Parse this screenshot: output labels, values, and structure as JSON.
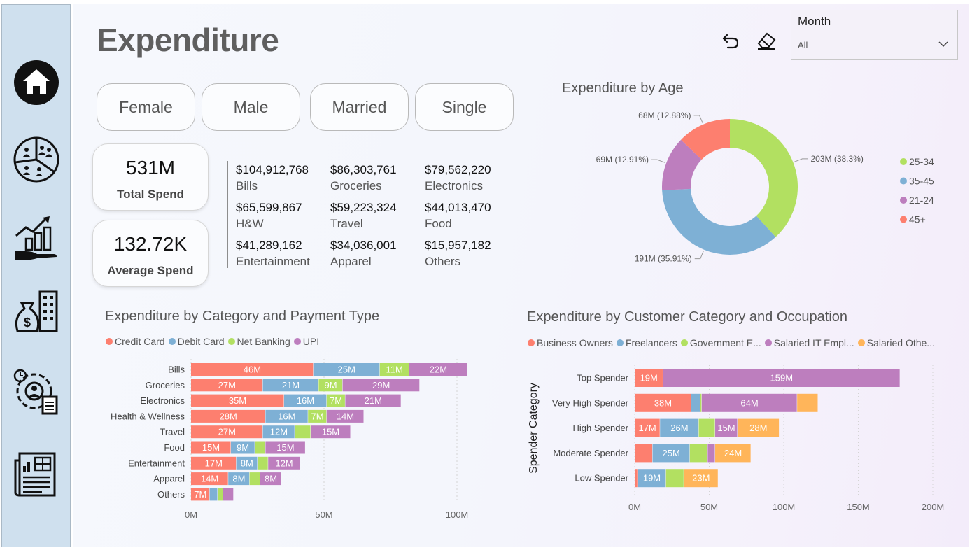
{
  "page": {
    "title": "Expenditure"
  },
  "toolbar": {
    "undo_icon": "undo-icon",
    "eraser_icon": "eraser-icon"
  },
  "slicer": {
    "title": "Month",
    "value": "All"
  },
  "sidebar": {
    "items": [
      {
        "name": "home",
        "icon": "home-icon"
      },
      {
        "name": "demographics",
        "icon": "people-pie-icon"
      },
      {
        "name": "growth",
        "icon": "money-growth-icon"
      },
      {
        "name": "finance",
        "icon": "money-bag-building-icon"
      },
      {
        "name": "settings-report",
        "icon": "gear-clock-document-icon"
      },
      {
        "name": "report",
        "icon": "newspaper-icon"
      }
    ]
  },
  "filters": [
    "Female",
    "Male",
    "Married",
    "Single"
  ],
  "kpis": {
    "total": {
      "value": "531M",
      "label": "Total Spend"
    },
    "average": {
      "value": "132.72K",
      "label": "Average Spend"
    }
  },
  "categories": [
    {
      "amount": "$104,912,768",
      "name": "Bills"
    },
    {
      "amount": "$86,303,761",
      "name": "Groceries"
    },
    {
      "amount": "$79,562,220",
      "name": "Electronics"
    },
    {
      "amount": "$65,599,867",
      "name": "H&W"
    },
    {
      "amount": "$59,223,324",
      "name": "Travel"
    },
    {
      "amount": "$44,013,470",
      "name": "Food"
    },
    {
      "amount": "$41,289,162",
      "name": "Entertainment"
    },
    {
      "amount": "$34,036,001",
      "name": "Apparel"
    },
    {
      "amount": "$15,957,182",
      "name": "Others"
    }
  ],
  "colors": {
    "credit_card": "#fd7f6f",
    "debit_card": "#7eb0d5",
    "net_banking": "#b2e061",
    "upi": "#bd7ebe",
    "salaried_other": "#ffb55a"
  },
  "chart_data": [
    {
      "type": "pie",
      "title": "Expenditure by Age",
      "variant": "donut",
      "categories": [
        "25-34",
        "35-45",
        "21-24",
        "45+"
      ],
      "values": [
        203,
        191,
        69,
        68
      ],
      "percent_labels": [
        "203M (38.3%)",
        "191M (35.91%)",
        "69M (12.91%)",
        "68M (12.88%)"
      ],
      "colors": [
        "#b2e061",
        "#7eb0d5",
        "#bd7ebe",
        "#fd7f6f"
      ],
      "legend": "right"
    },
    {
      "type": "bar",
      "orientation": "horizontal",
      "stacked": true,
      "title": "Expenditure by Category and Payment Type",
      "categories": [
        "Bills",
        "Groceries",
        "Electronics",
        "Health & Wellness",
        "Travel",
        "Food",
        "Entertainment",
        "Apparel",
        "Others"
      ],
      "series": [
        {
          "name": "Credit Card",
          "color": "#fd7f6f",
          "values": [
            46,
            27,
            35,
            28,
            27,
            15,
            17,
            14,
            7
          ]
        },
        {
          "name": "Debit Card",
          "color": "#7eb0d5",
          "values": [
            25,
            21,
            16,
            16,
            12,
            9,
            8,
            8,
            3
          ]
        },
        {
          "name": "Net Banking",
          "color": "#b2e061",
          "values": [
            11,
            9,
            7,
            7,
            6,
            4,
            4,
            4,
            2
          ]
        },
        {
          "name": "UPI",
          "color": "#bd7ebe",
          "values": [
            22,
            29,
            21,
            14,
            15,
            15,
            12,
            8,
            4
          ]
        }
      ],
      "data_labels": [
        [
          "46M",
          "25M",
          "11M",
          "22M"
        ],
        [
          "27M",
          "21M",
          "9M",
          "29M"
        ],
        [
          "35M",
          "16M",
          "7M",
          "21M"
        ],
        [
          "28M",
          "16M",
          "7M",
          "14M"
        ],
        [
          "27M",
          "12M",
          "",
          "15M"
        ],
        [
          "15M",
          "9M",
          "",
          "15M"
        ],
        [
          "17M",
          "8M",
          "",
          "12M"
        ],
        [
          "14M",
          "8M",
          "",
          "8M"
        ],
        [
          "7M",
          "",
          "",
          ""
        ]
      ],
      "x_ticks": [
        "0M",
        "50M",
        "100M"
      ],
      "x_tick_values": [
        0,
        50,
        100
      ],
      "xlim": [
        0,
        110
      ],
      "grid": true,
      "legend": "top-left"
    },
    {
      "type": "bar",
      "orientation": "horizontal",
      "stacked": true,
      "title": "Expenditure by Customer Category and Occupation",
      "ylabel": "Spender Category",
      "categories": [
        "Top Spender",
        "Very High Spender",
        "High Spender",
        "Moderate Spender",
        "Low Spender"
      ],
      "series": [
        {
          "name": "Business Owners",
          "color": "#fd7f6f",
          "values": [
            19,
            38,
            17,
            12,
            2
          ]
        },
        {
          "name": "Freelancers",
          "color": "#7eb0d5",
          "values": [
            0,
            6,
            26,
            25,
            19
          ]
        },
        {
          "name": "Government E...",
          "color": "#b2e061",
          "values": [
            0,
            1,
            11,
            12,
            12
          ]
        },
        {
          "name": "Salaried IT Empl...",
          "color": "#bd7ebe",
          "values": [
            159,
            64,
            15,
            5,
            0
          ]
        },
        {
          "name": "Salaried Othe...",
          "color": "#ffb55a",
          "values": [
            0,
            14,
            28,
            24,
            23
          ]
        }
      ],
      "data_labels": [
        [
          "19M",
          "",
          "",
          "159M",
          ""
        ],
        [
          "38M",
          "",
          "",
          "64M",
          ""
        ],
        [
          "17M",
          "26M",
          "",
          "15M",
          "28M"
        ],
        [
          "",
          "25M",
          "",
          "",
          "24M"
        ],
        [
          "",
          "19M",
          "",
          "",
          "23M"
        ]
      ],
      "x_ticks": [
        "0M",
        "50M",
        "100M",
        "150M",
        "200M"
      ],
      "x_tick_values": [
        0,
        50,
        100,
        150,
        200
      ],
      "xlim": [
        0,
        200
      ],
      "grid": true,
      "legend": "top-left"
    }
  ]
}
